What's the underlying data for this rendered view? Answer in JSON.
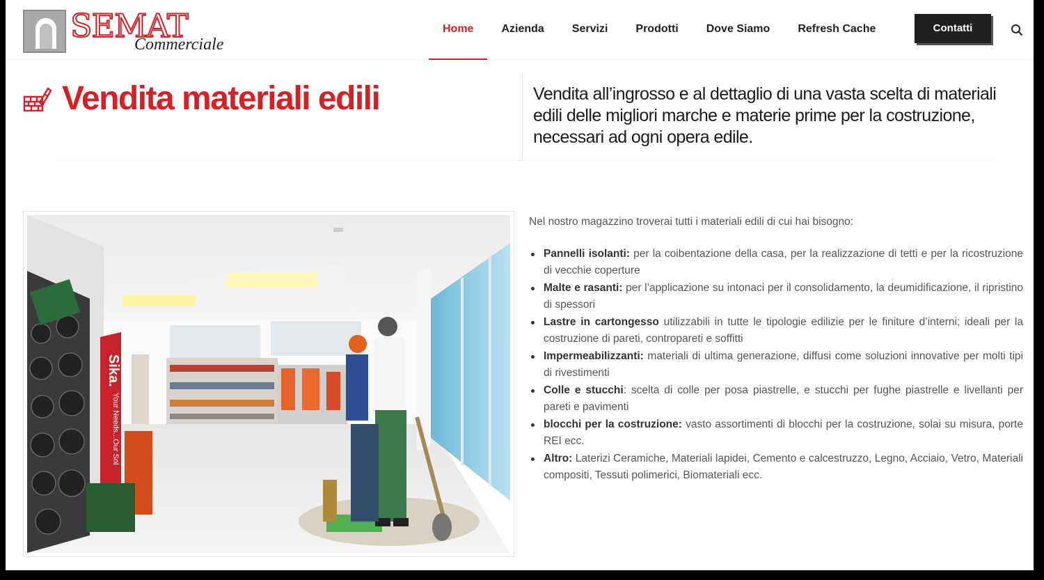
{
  "logo": {
    "brand_mark_text": "SEMAT",
    "subtitle": "Commerciale"
  },
  "nav": {
    "items": [
      {
        "label": "Home",
        "active": true
      },
      {
        "label": "Azienda",
        "active": false
      },
      {
        "label": "Servizi",
        "active": false
      },
      {
        "label": "Prodotti",
        "active": false
      },
      {
        "label": "Dove Siamo",
        "active": false
      },
      {
        "label": "Refresh Cache",
        "active": false
      }
    ],
    "contact_label": "Contatti",
    "search_icon": "search-icon"
  },
  "hero": {
    "icon": "building-materials-icon",
    "title": "Vendita materiali edili",
    "description": "Vendita all’ingrosso e al dettaglio di una vasta scelta di materiali edili delle migliori marche e materie prime per la costruzione, necessari ad ogni opera edile."
  },
  "content": {
    "intro": "Nel nostro magazzino troverai tutti i materiali edili di cui hai bisogno:",
    "items": [
      {
        "term": "Pannelli isolanti:",
        "text": " per la coibentazione della casa, per la realizzazione di tetti e per la ricostruzione di vecchie coperture"
      },
      {
        "term": "Malte e rasanti:",
        "text": " per l’applicazione su intonaci per il consolidamento, la deumidificazione, il ripristino di spessori"
      },
      {
        "term": "Lastre in cartongesso",
        "text": " utilizzabili in tutte le tipologie edilizie per le finiture d’interni; ideali per la costruzione di pareti, contropareti e soffitti"
      },
      {
        "term": "Impermeabilizzanti:",
        "text": " materiali di ultima generazione, diffusi come soluzioni innovative per molti tipi di rivestimenti"
      },
      {
        "term": "Colle e stucchi",
        "text": ": scelta di colle per posa piastrelle, e stucchi per fughe piastrelle e livellanti per pareti e pavimenti"
      },
      {
        "term": "blocchi per la costruzione:",
        "text": "  vasto assortimenti di blocchi per la costruzione, solai su misura, porte REI ecc."
      },
      {
        "term": "Altro:",
        "text": " Laterizi Ceramiche, Materiali lapidei, Cemento e calcestruzzo, Legno, Acciaio, Vetro, Materiali compositi, Tessuti polimerici, Biomateriali ecc."
      }
    ]
  },
  "photo": {
    "sign_text": "Sika.",
    "sign_tagline": "Your Needs...Our Sol"
  },
  "colors": {
    "accent": "#d71f26",
    "dark_button": "#1e1f21",
    "text": "#555555"
  }
}
